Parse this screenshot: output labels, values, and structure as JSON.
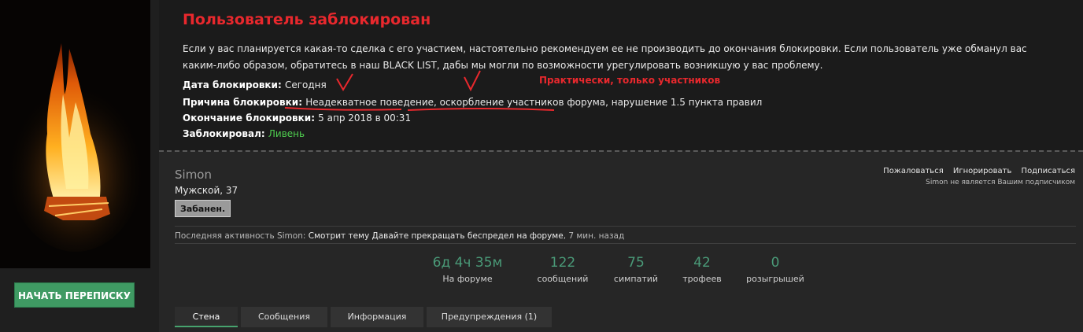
{
  "sidebar": {
    "message_button": "НАЧАТЬ ПЕРЕПИСКУ"
  },
  "ban": {
    "title": "Пользователь заблокирован",
    "text": "Если у вас планируется какая-то сделка с его участием, настоятельно рекомендуем ее не производить до окончания блокировки. Если пользователь уже обманул вас каким-либо образом, обратитесь в наш BLACK LIST, дабы мы могли по возможности урегулировать возникшую у вас проблему.",
    "date_label": "Дата блокировки",
    "date_value": "Сегодня",
    "reason_label": "Причина блокировки",
    "reason_part1": "Неадекватное поведение",
    "reason_sep1": ", ",
    "reason_part2": "оскорбление участников форума",
    "reason_part3": ", нарушение 1.5 пункта правил",
    "end_label": "Окончание блокировки",
    "end_value": "5 апр 2018 в 00:31",
    "by_label": "Заблокировал",
    "by_value": "Ливень",
    "colon": ": ",
    "annotation": "Практически, только участников"
  },
  "profile": {
    "name": "Simon",
    "info": "Мужской, 37",
    "badge": "Забанен.",
    "actions": [
      "Пожаловаться",
      "Игнорировать",
      "Подписаться"
    ],
    "subscribe_note": "Simon не является Вашим подписчиком",
    "activity": {
      "prefix": "Последняя активность Simon: ",
      "action": "Смотрит тему",
      "topic": " Давайте прекращать беспредел на форуме",
      "time": ", 7 мин. назад"
    },
    "stats": [
      {
        "value": "6д 4ч 35м",
        "label": "На форуме"
      },
      {
        "value": "122",
        "label": "сообщений"
      },
      {
        "value": "75",
        "label": "симпатий"
      },
      {
        "value": "42",
        "label": "трофеев"
      },
      {
        "value": "0",
        "label": "розыгрышей"
      }
    ],
    "tabs": [
      "Стена",
      "Сообщения",
      "Информация",
      "Предупреждения (1)"
    ]
  },
  "colors": {
    "accent_red": "#e8282d",
    "accent_green": "#47a36e",
    "stat_number": "#4a9a78"
  }
}
